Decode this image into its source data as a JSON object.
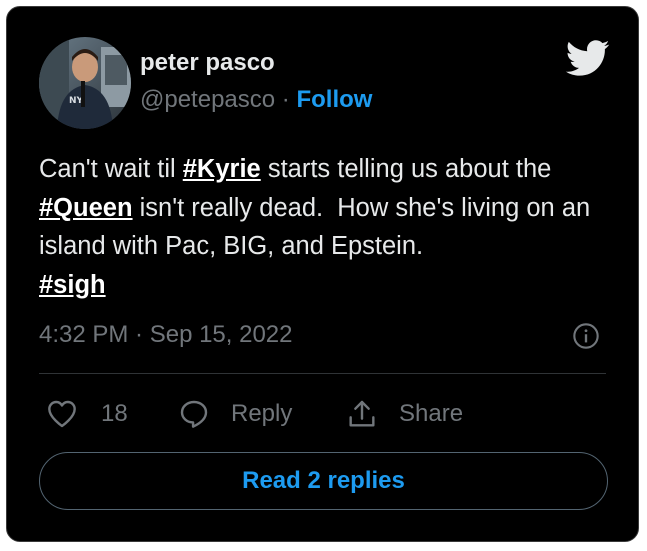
{
  "author": {
    "display_name": "peter pasco",
    "handle": "@petepasco",
    "separator": "·",
    "follow_label": "Follow"
  },
  "tweet": {
    "t1": "Can't wait til ",
    "hashtag_kyrie": "#Kyrie",
    "t2": " starts telling us about the ",
    "hashtag_queen": "#Queen",
    "t3": " isn't really dead.  How she's living on an island with Pac, BIG, and Epstein.",
    "hashtag_sigh": "#sigh"
  },
  "timestamp": "4:32 PM · Sep 15, 2022",
  "actions": {
    "like_count": "18",
    "reply_label": "Reply",
    "share_label": "Share"
  },
  "read_replies_label": "Read 2 replies",
  "icons": {
    "brand": "twitter-bird-icon",
    "info": "info-icon",
    "like": "heart-icon",
    "reply": "speech-bubble-icon",
    "share": "share-upload-icon"
  },
  "colors": {
    "background": "#000000",
    "text": "#e7e9ea",
    "muted": "#71767b",
    "accent": "#1d9bf0",
    "border": "#3a3a3a"
  }
}
